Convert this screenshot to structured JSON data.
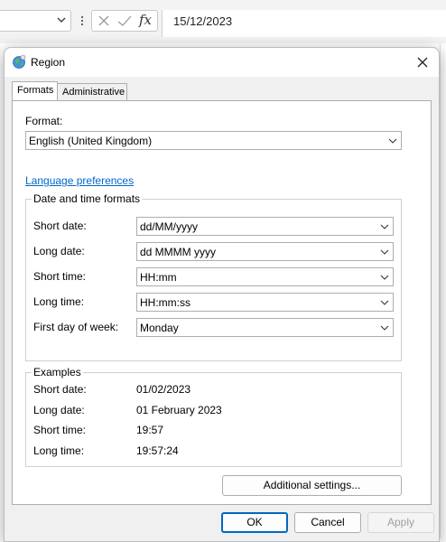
{
  "formula_bar": {
    "cell_value": "15/12/2023",
    "fx_label": "fx"
  },
  "dialog": {
    "title": "Region",
    "tabs": [
      {
        "label": "Formats",
        "active": true
      },
      {
        "label": "Administrative",
        "active": false
      }
    ],
    "format_label": "Format:",
    "format_value": "English (United Kingdom)",
    "language_link": "Language preferences",
    "date_time_group": {
      "title": "Date and time formats",
      "rows": [
        {
          "label": "Short date:",
          "value": "dd/MM/yyyy"
        },
        {
          "label": "Long date:",
          "value": "dd MMMM yyyy"
        },
        {
          "label": "Short time:",
          "value": "HH:mm"
        },
        {
          "label": "Long time:",
          "value": "HH:mm:ss"
        },
        {
          "label": "First day of week:",
          "value": "Monday"
        }
      ]
    },
    "examples_group": {
      "title": "Examples",
      "rows": [
        {
          "label": "Short date:",
          "value": "01/02/2023"
        },
        {
          "label": "Long date:",
          "value": "01 February 2023"
        },
        {
          "label": "Short time:",
          "value": "19:57"
        },
        {
          "label": "Long time:",
          "value": "19:57:24"
        }
      ]
    },
    "additional_settings_label": "Additional settings...",
    "ok_label": "OK",
    "cancel_label": "Cancel",
    "apply_label": "Apply",
    "accent_color": "#0067c0"
  }
}
